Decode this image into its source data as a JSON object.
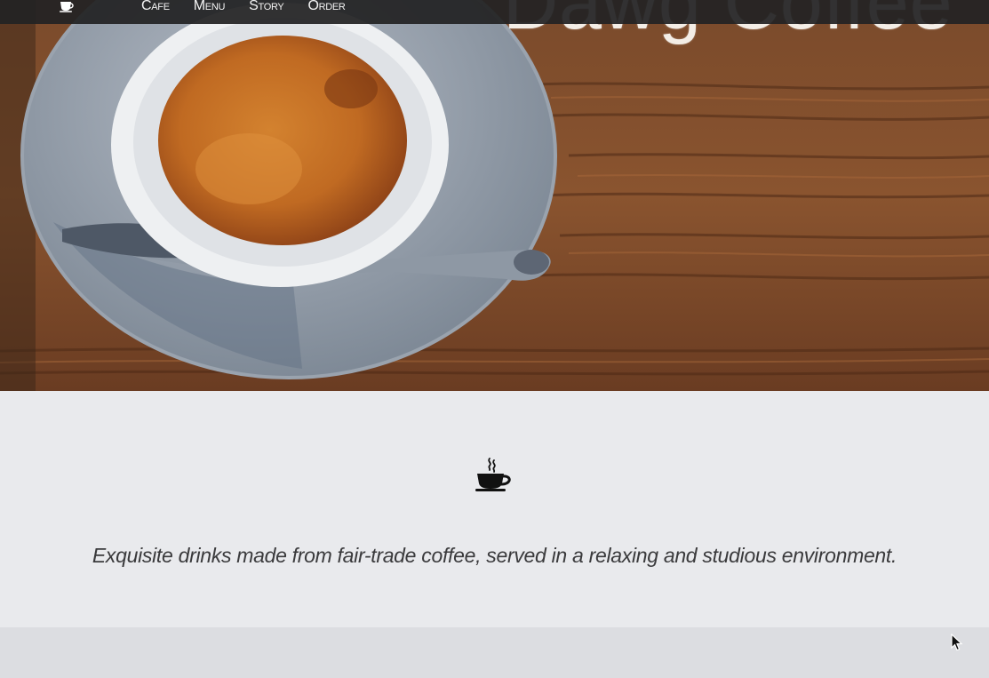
{
  "navbar": {
    "logo_icon": "coffee-cup-icon",
    "links": [
      {
        "label": "Cafe"
      },
      {
        "label": "Menu"
      },
      {
        "label": "Story"
      },
      {
        "label": "Order"
      }
    ]
  },
  "hero": {
    "title": "Dawg Coffee",
    "image": "espresso-cup-on-wooden-table"
  },
  "intro": {
    "icon": "coffee-cup-icon",
    "tagline": "Exquisite drinks made from fair-trade coffee, served in a relaxing and studious environment."
  },
  "colors": {
    "navbar_bg": "#222224",
    "section_bg": "#e9eaed",
    "lower_band_bg": "#dcdde1",
    "text": "#3a3a3c"
  }
}
